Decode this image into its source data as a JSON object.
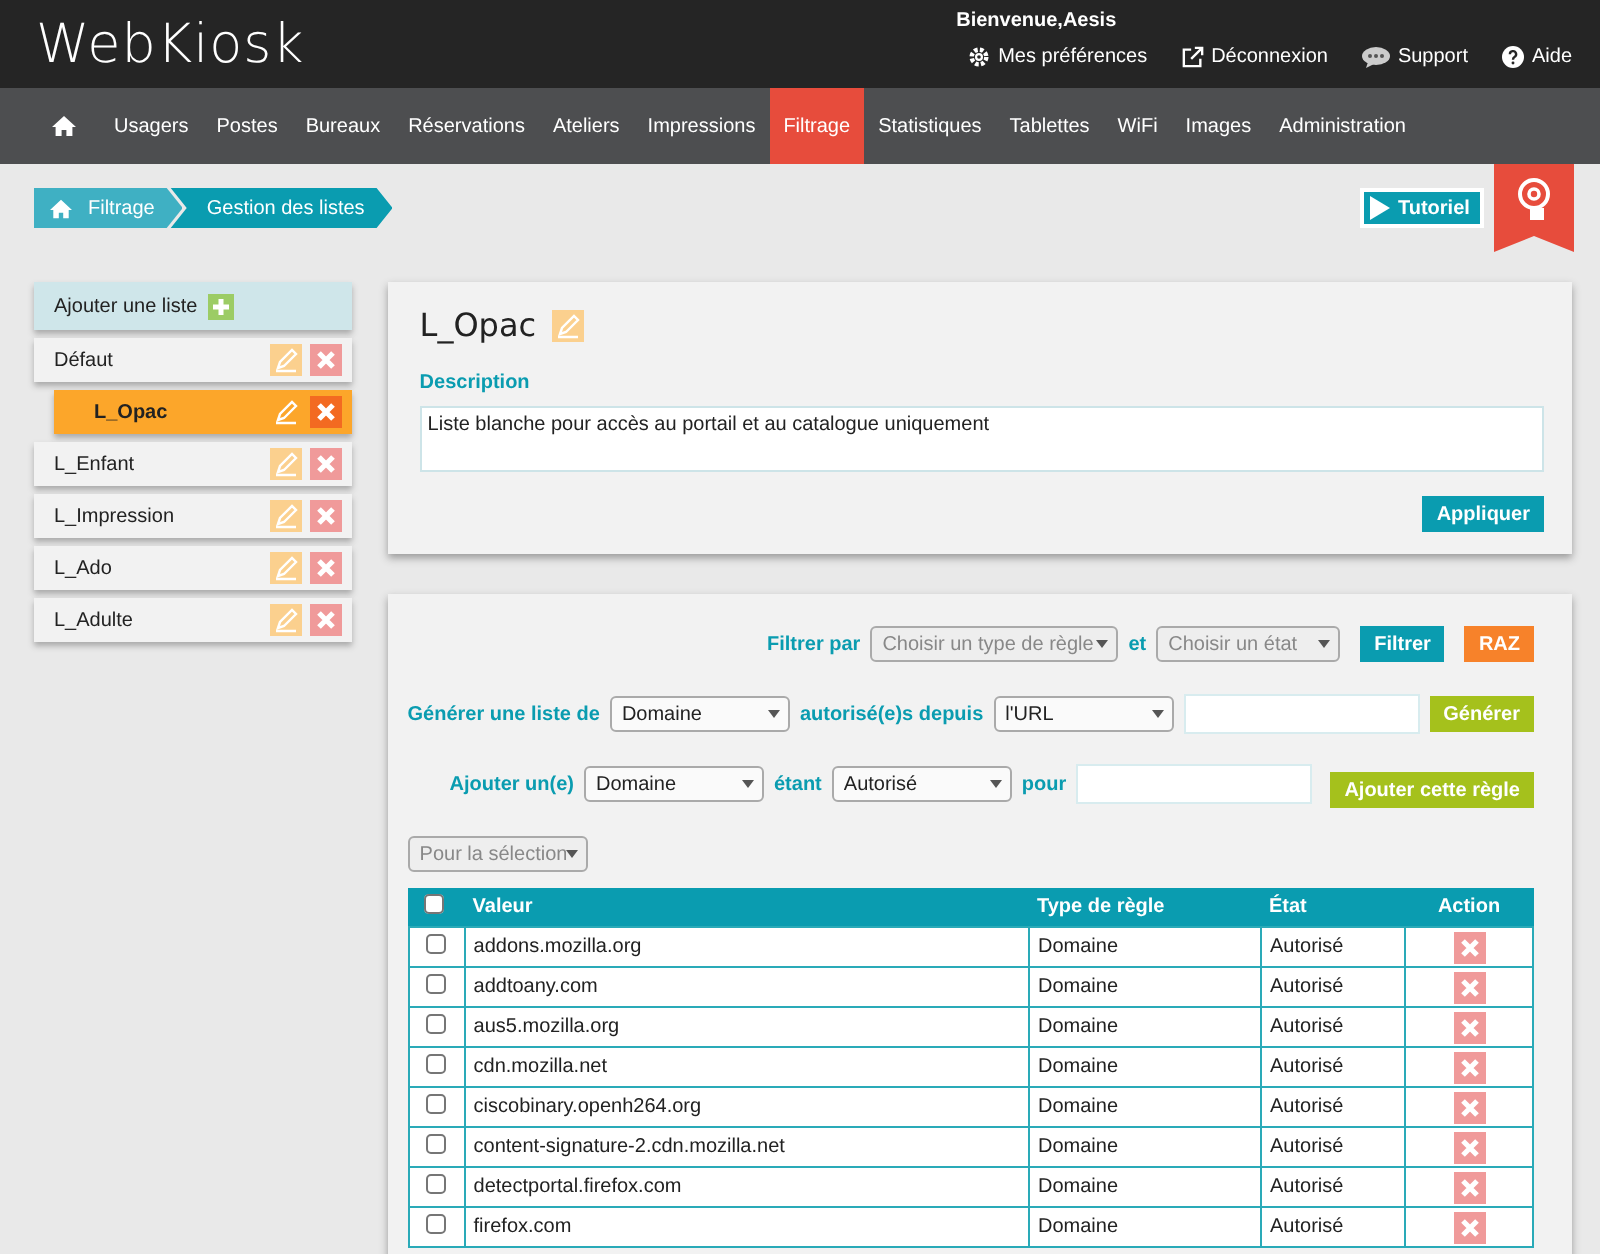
{
  "header": {
    "logo": "WebKiosk",
    "welcome": "Bienvenue,Aesis",
    "links": [
      {
        "kind": "gear",
        "label": "Mes préférences"
      },
      {
        "kind": "exit",
        "label": "Déconnexion"
      },
      {
        "kind": "chat",
        "label": "Support"
      },
      {
        "kind": "help",
        "label": "Aide"
      }
    ]
  },
  "nav": [
    {
      "label": "Usagers",
      "selected": false
    },
    {
      "label": "Postes",
      "selected": false
    },
    {
      "label": "Bureaux",
      "selected": false
    },
    {
      "label": "Réservations",
      "selected": false
    },
    {
      "label": "Ateliers",
      "selected": false
    },
    {
      "label": "Impressions",
      "selected": false
    },
    {
      "label": "Filtrage",
      "selected": true
    },
    {
      "label": "Statistiques",
      "selected": false
    },
    {
      "label": "Tablettes",
      "selected": false
    },
    {
      "label": "WiFi",
      "selected": false
    },
    {
      "label": "Images",
      "selected": false
    },
    {
      "label": "Administration",
      "selected": false
    }
  ],
  "breadcrumb": [
    "Filtrage",
    "Gestion des listes"
  ],
  "tutorial_button": "Tutoriel",
  "sidebar": {
    "add_label": "Ajouter une liste",
    "items": [
      {
        "label": "Défaut",
        "selected": false,
        "children": [
          {
            "label": "L_Opac",
            "selected": true
          }
        ]
      },
      {
        "label": "L_Enfant",
        "selected": false
      },
      {
        "label": "L_Impression",
        "selected": false
      },
      {
        "label": "L_Ado",
        "selected": false
      },
      {
        "label": "L_Adulte",
        "selected": false
      }
    ]
  },
  "detail": {
    "title": "L_Opac",
    "description_label": "Description",
    "description": "Liste blanche pour accès au portail et au catalogue uniquement",
    "apply_button": "Appliquer"
  },
  "filter": {
    "label": "Filtrer par",
    "type_select": {
      "placeholder": "Choisir un type de règle"
    },
    "and": "et",
    "state_select": {
      "placeholder": "Choisir un état"
    },
    "filter_button": "Filtrer",
    "reset_button": "RAZ"
  },
  "generate": {
    "label": "Générer une liste de",
    "type_select": "Domaine",
    "middle": "autorisé(e)s depuis",
    "source_select": "l'URL",
    "button": "Générer"
  },
  "add_rule": {
    "label": "Ajouter un(e)",
    "type_select": "Domaine",
    "middle": "étant",
    "state_select": "Autorisé",
    "for": "pour",
    "button": "Ajouter cette règle"
  },
  "bulk_select": {
    "placeholder": "Pour la sélection"
  },
  "table": {
    "select_all_checked": false,
    "columns": [
      "Valeur",
      "Type de règle",
      "État",
      "Action"
    ],
    "rows": [
      {
        "value": "addons.mozilla.org",
        "type": "Domaine",
        "state": "Autorisé",
        "checked": false
      },
      {
        "value": "addtoany.com",
        "type": "Domaine",
        "state": "Autorisé",
        "checked": false
      },
      {
        "value": "aus5.mozilla.org",
        "type": "Domaine",
        "state": "Autorisé",
        "checked": false
      },
      {
        "value": "cdn.mozilla.net",
        "type": "Domaine",
        "state": "Autorisé",
        "checked": false
      },
      {
        "value": "ciscobinary.openh264.org",
        "type": "Domaine",
        "state": "Autorisé",
        "checked": false
      },
      {
        "value": "content-signature-2.cdn.mozilla.net",
        "type": "Domaine",
        "state": "Autorisé",
        "checked": false
      },
      {
        "value": "detectportal.firefox.com",
        "type": "Domaine",
        "state": "Autorisé",
        "checked": false
      },
      {
        "value": "firefox.com",
        "type": "Domaine",
        "state": "Autorisé",
        "checked": false
      }
    ]
  }
}
